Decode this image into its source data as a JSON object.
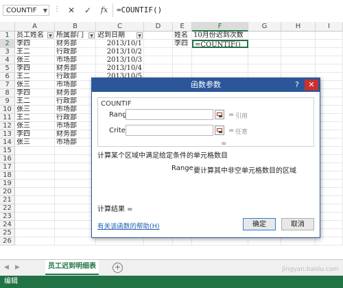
{
  "formula_bar": {
    "name_box": "COUNTIF",
    "cancel_symbol": "✕",
    "enter_symbol": "✓",
    "fx_symbol": "fx",
    "formula": "=COUNTIF()"
  },
  "columns": [
    "A",
    "B",
    "C",
    "D",
    "E",
    "F",
    "G",
    "H",
    "I"
  ],
  "rows": [
    "1",
    "2",
    "3",
    "4",
    "5",
    "6",
    "7",
    "8",
    "9",
    "10",
    "11",
    "12",
    "13",
    "14",
    "15",
    "16",
    "17",
    "18",
    "19",
    "20",
    "21",
    "22",
    "23",
    "24",
    "25",
    "26"
  ],
  "headers": {
    "a": "员工姓名",
    "b": "所属部门",
    "c": "迟到日期"
  },
  "data_rows": [
    {
      "name": "李四",
      "dept": "财务部",
      "date": "2013/10/1"
    },
    {
      "name": "王二",
      "dept": "行政部",
      "date": "2013/10/2"
    },
    {
      "name": "张三",
      "dept": "市场部",
      "date": "2013/10/3"
    },
    {
      "name": "李四",
      "dept": "财务部",
      "date": "2013/10/4"
    },
    {
      "name": "王二",
      "dept": "行政部",
      "date": "2013/10/5"
    },
    {
      "name": "张三",
      "dept": "市场部",
      "date": ""
    },
    {
      "name": "李四",
      "dept": "财务部",
      "date": ""
    },
    {
      "name": "王二",
      "dept": "行政部",
      "date": ""
    },
    {
      "name": "张三",
      "dept": "市场部",
      "date": ""
    },
    {
      "name": "王二",
      "dept": "行政部",
      "date": ""
    },
    {
      "name": "张三",
      "dept": "市场部",
      "date": ""
    },
    {
      "name": "李四",
      "dept": "财务部",
      "date": ""
    },
    {
      "name": "张三",
      "dept": "市场部",
      "date": ""
    }
  ],
  "side_table": {
    "e1": "姓名",
    "f1": "10月份迟到次数",
    "e2": "李四",
    "f2": "=COUNTIF()"
  },
  "sheet": {
    "tab_label": "员工迟到明细表",
    "add_symbol": "+",
    "nav_prev": "◀",
    "nav_next": "▶"
  },
  "status": "编辑",
  "dialog": {
    "title": "函数参数",
    "help": "?",
    "close": "✕",
    "function_name": "COUNTIF",
    "arg1_label": "Range",
    "arg1_hint": "引用",
    "arg2_label": "Criteria",
    "arg2_hint": "任意",
    "equals": "=",
    "description": "计算某个区域中满足给定条件的单元格数目",
    "arg_desc_name": "Range",
    "arg_desc_text": "要计算其中非空单元格数目的区域",
    "result_label": "计算结果 =",
    "help_link": "有关该函数的帮助(H)",
    "ok": "确定",
    "cancel": "取消"
  },
  "watermark": "jingyan.baidu.com",
  "colors": {
    "excel_green": "#217346",
    "dialog_blue": "#2b579a",
    "close_red": "#c7312f",
    "link": "#1e5fb3"
  }
}
